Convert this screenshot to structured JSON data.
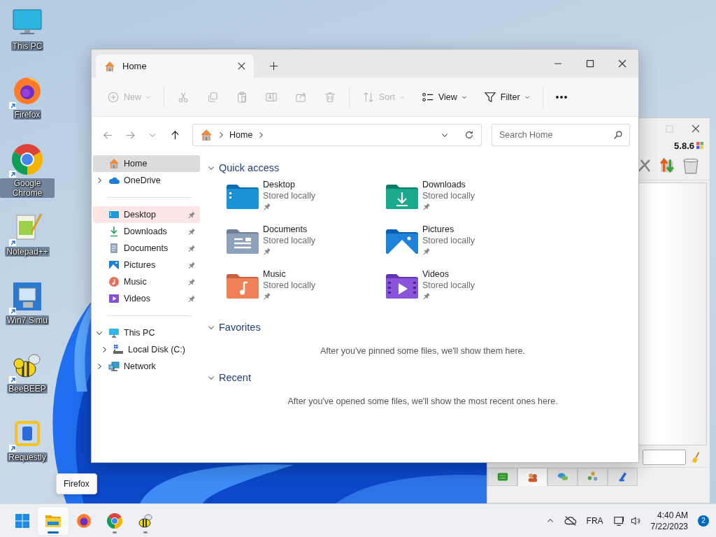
{
  "desktop_icons": [
    {
      "label": "This PC",
      "kind": "this-pc",
      "shortcut": false
    },
    {
      "label": "Firefox",
      "kind": "firefox",
      "shortcut": true
    },
    {
      "label": "Google Chrome",
      "kind": "chrome",
      "shortcut": true
    },
    {
      "label": "Notepad++",
      "kind": "notepad",
      "shortcut": true
    },
    {
      "label": "Win7 Simu",
      "kind": "win7",
      "shortcut": true
    },
    {
      "label": "BeeBEEP",
      "kind": "bee",
      "shortcut": true
    },
    {
      "label": "Requestly",
      "kind": "requestly",
      "shortcut": true
    }
  ],
  "background_window": {
    "version": "5.8.6",
    "tabs": [
      {
        "kind": "chat-list",
        "selected": false
      },
      {
        "kind": "users",
        "selected": true
      },
      {
        "kind": "chat",
        "selected": false
      },
      {
        "kind": "groups",
        "selected": false
      },
      {
        "kind": "network",
        "selected": false
      }
    ]
  },
  "explorer": {
    "tabs": [
      {
        "label": "Home",
        "selected": true
      }
    ],
    "toolbar": [
      {
        "kind": "new",
        "label": "New",
        "disabled": true,
        "dropdown": true,
        "separator_after": true
      },
      {
        "kind": "cut",
        "disabled": true
      },
      {
        "kind": "copy",
        "disabled": true
      },
      {
        "kind": "paste",
        "disabled": true
      },
      {
        "kind": "rename",
        "disabled": true
      },
      {
        "kind": "share",
        "disabled": true
      },
      {
        "kind": "delete",
        "disabled": true,
        "separator_after": true
      },
      {
        "kind": "sort",
        "label": "Sort",
        "disabled": true,
        "dropdown": true
      },
      {
        "kind": "view",
        "label": "View",
        "disabled": false,
        "dropdown": true
      },
      {
        "kind": "filter",
        "label": "Filter",
        "disabled": false,
        "dropdown": true,
        "separator_after": true
      },
      {
        "kind": "more",
        "disabled": false
      }
    ],
    "navigation": {
      "back_disabled": true,
      "forward_disabled": true,
      "up_disabled": false
    },
    "address": {
      "crumbs": [
        "Home"
      ]
    },
    "search": {
      "placeholder": "Search Home"
    },
    "sidebar": [
      {
        "items": [
          {
            "label": "Home",
            "kind": "home",
            "selected": true,
            "hovered": false,
            "pinned": false
          },
          {
            "label": "OneDrive",
            "kind": "cloud",
            "selected": false,
            "hovered": false,
            "pinned": false,
            "expanded": false
          }
        ]
      },
      {
        "items": [
          {
            "label": "Desktop",
            "kind": "desktop",
            "selected": false,
            "hovered": true,
            "pinned": true
          },
          {
            "label": "Downloads",
            "kind": "download",
            "selected": false,
            "hovered": false,
            "pinned": true
          },
          {
            "label": "Documents",
            "kind": "documents",
            "selected": false,
            "hovered": false,
            "pinned": true
          },
          {
            "label": "Pictures",
            "kind": "pictures",
            "selected": false,
            "hovered": false,
            "pinned": true
          },
          {
            "label": "Music",
            "kind": "music",
            "selected": false,
            "hovered": false,
            "pinned": true
          },
          {
            "label": "Videos",
            "kind": "videos",
            "selected": false,
            "hovered": false,
            "pinned": true
          }
        ]
      },
      {
        "items": [
          {
            "label": "This PC",
            "kind": "pc",
            "selected": false,
            "hovered": false,
            "pinned": false,
            "expanded": true,
            "children": [
              {
                "label": "Local Disk (C:)",
                "kind": "disk",
                "selected": false,
                "hovered": false,
                "pinned": false,
                "expanded": false
              }
            ]
          },
          {
            "label": "Network",
            "kind": "network",
            "selected": false,
            "hovered": false,
            "pinned": false,
            "expanded": false
          }
        ]
      }
    ],
    "sections": [
      {
        "title": "Quick access",
        "expanded": true,
        "folders": [
          {
            "name": "Desktop",
            "status": "Stored locally",
            "kind": "desktop",
            "pinned": true
          },
          {
            "name": "Downloads",
            "status": "Stored locally",
            "kind": "downloads",
            "pinned": true
          },
          {
            "name": "Documents",
            "status": "Stored locally",
            "kind": "documents",
            "pinned": true
          },
          {
            "name": "Pictures",
            "status": "Stored locally",
            "kind": "pictures",
            "pinned": true
          },
          {
            "name": "Music",
            "status": "Stored locally",
            "kind": "music",
            "pinned": true
          },
          {
            "name": "Videos",
            "status": "Stored locally",
            "kind": "videos",
            "pinned": true
          }
        ]
      },
      {
        "title": "Favorites",
        "expanded": true,
        "message": "After you've pinned some files, we'll show them here."
      },
      {
        "title": "Recent",
        "expanded": true,
        "message": "After you've opened some files, we'll show the most recent ones here."
      }
    ]
  },
  "tooltip": {
    "text": "Firefox"
  },
  "taskbar": {
    "apps": [
      {
        "kind": "start",
        "running": false,
        "active": false
      },
      {
        "kind": "explorer",
        "running": true,
        "active": true
      },
      {
        "kind": "firefox",
        "running": false,
        "active": false
      },
      {
        "kind": "chrome",
        "running": true,
        "active": false
      },
      {
        "kind": "bee",
        "running": true,
        "active": false
      }
    ],
    "language": "FRA",
    "time": "4:40 AM",
    "date": "7/22/2023",
    "notifications": "2"
  }
}
